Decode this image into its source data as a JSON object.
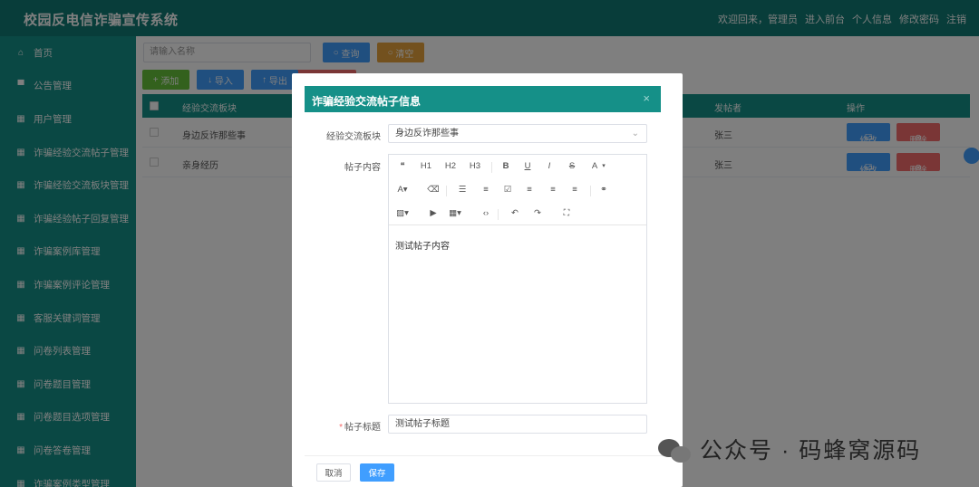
{
  "header": {
    "title": "校园反电信诈骗宣传系统",
    "welcome": "欢迎回来，管理员",
    "front_link": "进入前台",
    "profile_link": "个人信息",
    "password_link": "修改密码",
    "logout_link": "注销"
  },
  "sidebar": {
    "items": [
      {
        "label": "首页",
        "icon": "home-icon"
      },
      {
        "label": "公告管理",
        "icon": "notice-icon"
      },
      {
        "label": "用户管理",
        "icon": "grid-icon"
      },
      {
        "label": "诈骗经验交流帖子管理",
        "icon": "grid-icon"
      },
      {
        "label": "诈骗经验交流板块管理",
        "icon": "grid-icon"
      },
      {
        "label": "诈骗经验帖子回复管理",
        "icon": "grid-icon"
      },
      {
        "label": "诈骗案例库管理",
        "icon": "grid-icon"
      },
      {
        "label": "诈骗案例评论管理",
        "icon": "grid-icon"
      },
      {
        "label": "客服关键词管理",
        "icon": "grid-icon"
      },
      {
        "label": "问卷列表管理",
        "icon": "grid-icon"
      },
      {
        "label": "问卷题目管理",
        "icon": "grid-icon"
      },
      {
        "label": "问卷题目选项管理",
        "icon": "grid-icon"
      },
      {
        "label": "问卷答卷管理",
        "icon": "grid-icon"
      },
      {
        "label": "诈骗案例类型管理",
        "icon": "grid-icon"
      }
    ]
  },
  "toolbar": {
    "search_placeholder": "请输入名称",
    "query_label": "查询",
    "reset_label": "清空",
    "add_label": "添加",
    "import_label": "导入",
    "export_label": "导出"
  },
  "table": {
    "columns": [
      "经验交流板块",
      "发帖者",
      "操作"
    ],
    "rows": [
      {
        "board": "身边反诈那些事",
        "author": "张三"
      },
      {
        "board": "亲身经历",
        "author": "张三"
      }
    ],
    "edit_label": "修改",
    "delete_label": "删除"
  },
  "dialog": {
    "title": "诈骗经验交流帖子信息",
    "board_label": "经验交流板块",
    "board_value": "身边反诈那些事",
    "content_label": "帖子内容",
    "content_value": "测试帖子内容",
    "post_title_label": "帖子标题",
    "post_title_value": "测试帖子标题",
    "cancel_label": "取消",
    "save_label": "保存",
    "editor_toolbar": {
      "h1": "H1",
      "h2": "H2",
      "h3": "H3",
      "bold": "B",
      "underline": "U",
      "italic": "I",
      "strike": "S",
      "color": "A"
    }
  },
  "watermark": {
    "text": "公众号 · 码蜂窝源码"
  },
  "colors": {
    "header_bg": "#117a74",
    "sidebar_bg": "#159088",
    "primary": "#409eff",
    "warning": "#e6a23c",
    "success": "#67c23a",
    "danger": "#f56c6c"
  }
}
